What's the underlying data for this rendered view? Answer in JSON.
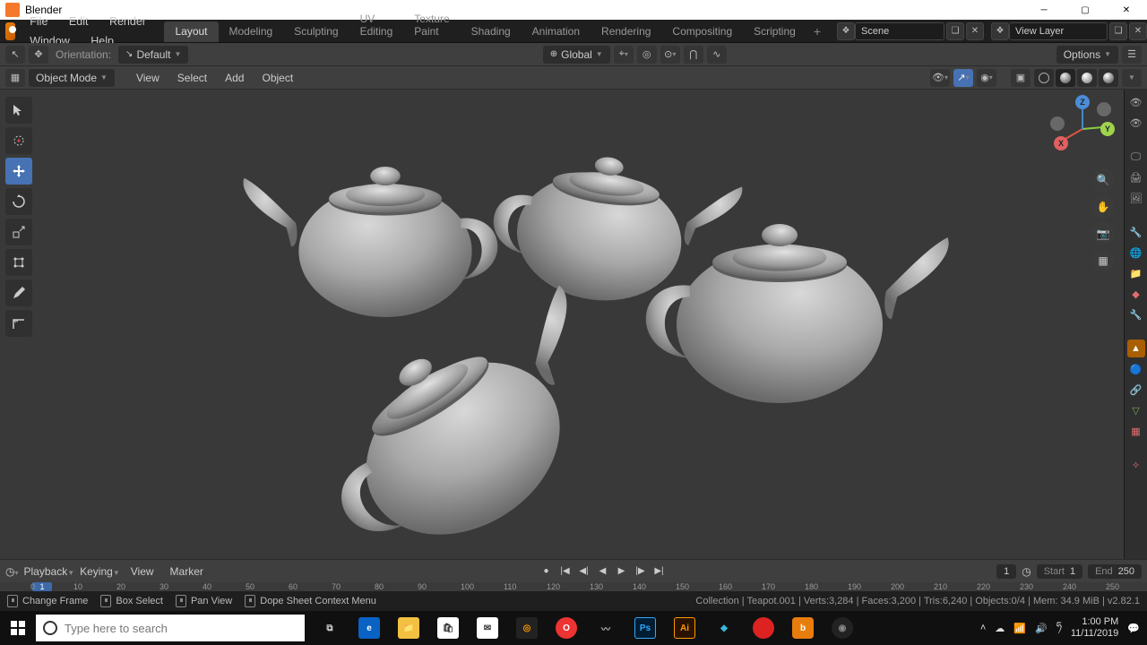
{
  "title": "Blender",
  "menu": [
    "File",
    "Edit",
    "Render",
    "Window",
    "Help"
  ],
  "workspaces": [
    "Layout",
    "Modeling",
    "Sculpting",
    "UV Editing",
    "Texture Paint",
    "Shading",
    "Animation",
    "Rendering",
    "Compositing",
    "Scripting"
  ],
  "active_workspace": "Layout",
  "scene": "Scene",
  "viewlayer": "View Layer",
  "toolhdr1": {
    "orientation_label": "Orientation:",
    "orientation_value": "Default"
  },
  "toolhdr1_right": {
    "transform": "Global",
    "options": "Options"
  },
  "toolhdr2": {
    "mode": "Object Mode",
    "items": [
      "View",
      "Select",
      "Add",
      "Object"
    ]
  },
  "timeline": {
    "menu": [
      "Playback",
      "Keying",
      "View",
      "Marker"
    ],
    "current": 1,
    "start_label": "Start",
    "start": 1,
    "end_label": "End",
    "end": 250,
    "ticks": [
      0,
      10,
      20,
      30,
      40,
      50,
      60,
      70,
      80,
      90,
      100,
      110,
      120,
      130,
      140,
      150,
      160,
      170,
      180,
      190,
      200,
      210,
      220,
      230,
      240,
      250
    ]
  },
  "hints": [
    {
      "k": "Change Frame"
    },
    {
      "k": "Box Select"
    },
    {
      "k": "Pan View"
    },
    {
      "k": "Dope Sheet Context Menu"
    }
  ],
  "stats": {
    "collection": "Collection",
    "object": "Teapot.001",
    "verts": "3,284",
    "faces": "3,200",
    "tris": "6,240",
    "objects": "0/4",
    "mem": "34.9 MiB",
    "ver": "v2.82.1"
  },
  "taskbar": {
    "search_placeholder": "Type here to search",
    "time": "1:00 PM",
    "date": "11/11/2019"
  }
}
